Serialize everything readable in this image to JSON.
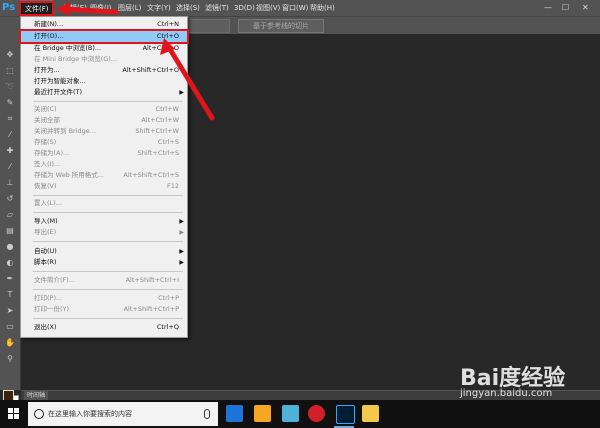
{
  "app": {
    "logo": "Ps"
  },
  "menubar": {
    "items": [
      "文件(F)",
      "编辑(E)",
      "图像(I)",
      "图层(L)",
      "文字(Y)",
      "选择(S)",
      "滤镜(T)",
      "3D(D)",
      "视图(V)",
      "窗口(W)",
      "帮助(H)"
    ],
    "window_controls": [
      "—",
      "☐",
      "✕"
    ]
  },
  "optbar": {
    "slice_button": "基于参考线的切片"
  },
  "file_menu": {
    "items": [
      {
        "label": "新建(N)...",
        "shortcut": "Ctrl+N"
      },
      {
        "label": "打开(O)...",
        "shortcut": "Ctrl+O"
      },
      {
        "label": "在 Bridge 中浏览(B)...",
        "shortcut": "Alt+Ctrl+O"
      },
      {
        "label": "在 Mini Bridge 中浏览(G)...",
        "shortcut": ""
      },
      {
        "label": "打开为...",
        "shortcut": "Alt+Shift+Ctrl+O"
      },
      {
        "label": "打开为智能对象...",
        "shortcut": ""
      },
      {
        "label": "最近打开文件(T)",
        "shortcut": ""
      },
      {
        "label": "关闭(C)",
        "shortcut": "Ctrl+W"
      },
      {
        "label": "关闭全部",
        "shortcut": "Alt+Ctrl+W"
      },
      {
        "label": "关闭并转到 Bridge...",
        "shortcut": "Shift+Ctrl+W"
      },
      {
        "label": "存储(S)",
        "shortcut": "Ctrl+S"
      },
      {
        "label": "存储为(A)...",
        "shortcut": "Shift+Ctrl+S"
      },
      {
        "label": "签入(I)...",
        "shortcut": ""
      },
      {
        "label": "存储为 Web 所用格式...",
        "shortcut": "Alt+Shift+Ctrl+S"
      },
      {
        "label": "恢复(V)",
        "shortcut": "F12"
      },
      {
        "label": "置入(L)...",
        "shortcut": ""
      },
      {
        "label": "导入(M)",
        "shortcut": ""
      },
      {
        "label": "导出(E)",
        "shortcut": ""
      },
      {
        "label": "自动(U)",
        "shortcut": ""
      },
      {
        "label": "脚本(R)",
        "shortcut": ""
      },
      {
        "label": "文件简介(F)...",
        "shortcut": "Alt+Shift+Ctrl+I"
      },
      {
        "label": "打印(P)...",
        "shortcut": "Ctrl+P"
      },
      {
        "label": "打印一份(Y)",
        "shortcut": "Alt+Shift+Ctrl+P"
      },
      {
        "label": "退出(X)",
        "shortcut": "Ctrl+Q"
      }
    ]
  },
  "timeline": {
    "tab": "时间轴"
  },
  "taskbar": {
    "search_placeholder": "在这里输入你要搜索的内容"
  },
  "watermark": {
    "brand": "Bai度经验",
    "url": "jingyan.baidu.com"
  },
  "colors": {
    "highlight": "#91c9f7",
    "annotation_red": "#e0141b",
    "ps_blue": "#31a8ff"
  }
}
